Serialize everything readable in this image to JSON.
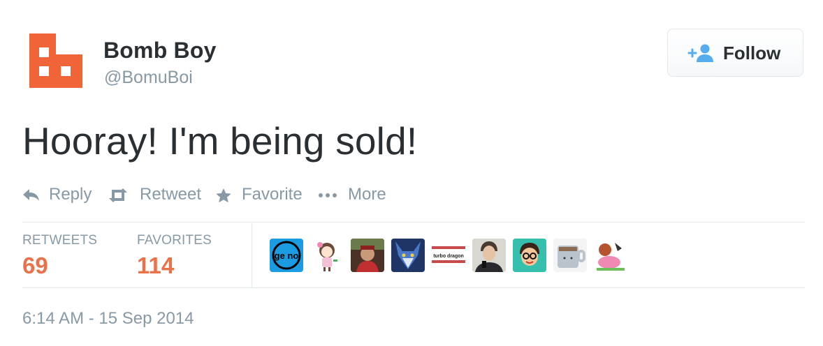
{
  "user": {
    "display_name": "Bomb Boy",
    "username": "@BomuBoi",
    "avatar_color": "#f06437"
  },
  "follow_button": {
    "label": "Follow",
    "icon": "add-user-icon"
  },
  "tweet": {
    "text": "Hooray! I'm being sold!"
  },
  "actions": [
    {
      "label": "Reply",
      "icon": "reply-icon"
    },
    {
      "label": "Retweet",
      "icon": "retweet-icon"
    },
    {
      "label": "Favorite",
      "icon": "star-icon"
    },
    {
      "label": "More",
      "icon": "more-dots-icon"
    }
  ],
  "stats": {
    "retweets_label": "RETWEETS",
    "retweets_count": "69",
    "favorites_label": "FAVORITES",
    "favorites_count": "114"
  },
  "favoriter_avatars": [
    {
      "name": "geno",
      "text": "ge no"
    },
    {
      "name": "pink-girl-drawing"
    },
    {
      "name": "red-costume-photo"
    },
    {
      "name": "blue-wolf-art"
    },
    {
      "name": "turbo-dragon",
      "text": "turbo dragon"
    },
    {
      "name": "selfie-photo"
    },
    {
      "name": "cartoon-glasses-face"
    },
    {
      "name": "pixel-mug"
    },
    {
      "name": "pink-creature-art"
    }
  ],
  "timestamp": "6:14 AM - 15 Sep 2014",
  "colors": {
    "text": "#292f33",
    "muted": "#8899a6",
    "stat_value": "#e8734a",
    "follow_icon": "#55acee",
    "divider": "#e1e8ed"
  }
}
